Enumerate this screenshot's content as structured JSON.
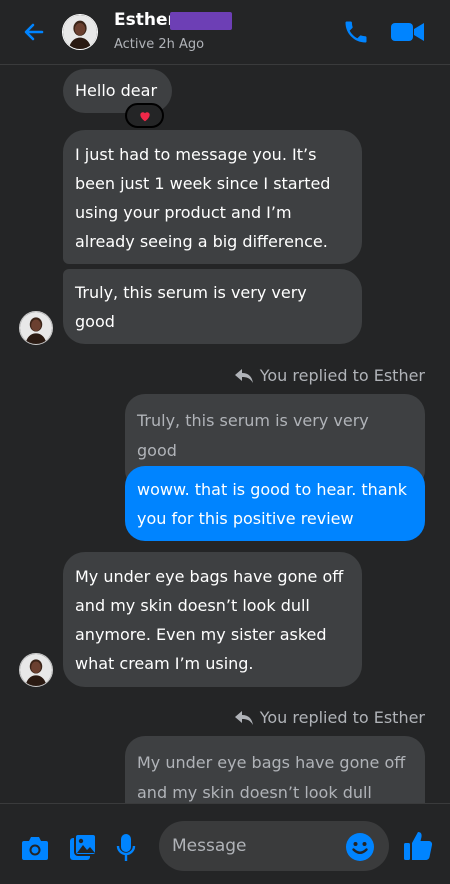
{
  "header": {
    "contact_name": "Esther",
    "status": "Active 2h Ago"
  },
  "messages": [
    {
      "from": "contact",
      "text": "Hello dear",
      "reaction": "red-heart-emoji"
    },
    {
      "from": "contact",
      "text": "I just had to message you. It’s been just 1 week since I started using your product and I’m already seeing a big difference."
    },
    {
      "from": "contact",
      "text": "Truly, this serum is very very good"
    },
    {
      "from": "me",
      "replied_label": "You replied to Esther",
      "quoted": "Truly, this serum is very very good",
      "text": "woww. that is good to hear. thank you for this positive review"
    },
    {
      "from": "contact",
      "text": "My under eye bags have gone off and my skin doesn’t look dull anymore. Even my sister asked what cream I’m using."
    },
    {
      "from": "me",
      "replied_label": "You replied to Esther",
      "quoted": "My under eye bags have gone off and my skin doesn’t look dull"
    }
  ],
  "composer": {
    "placeholder": "Message"
  },
  "colors": {
    "background": "#242526",
    "bubble_incoming": "#3e4042",
    "bubble_outgoing": "#0084ff",
    "icon_accent": "#0084ff",
    "redaction": "#6d3fb5"
  },
  "icons": [
    "back-arrow-icon",
    "phone-icon",
    "video-call-icon",
    "reply-arrow-icon",
    "camera-icon",
    "gallery-icon",
    "microphone-icon",
    "emoji-icon",
    "thumbs-up-icon"
  ]
}
